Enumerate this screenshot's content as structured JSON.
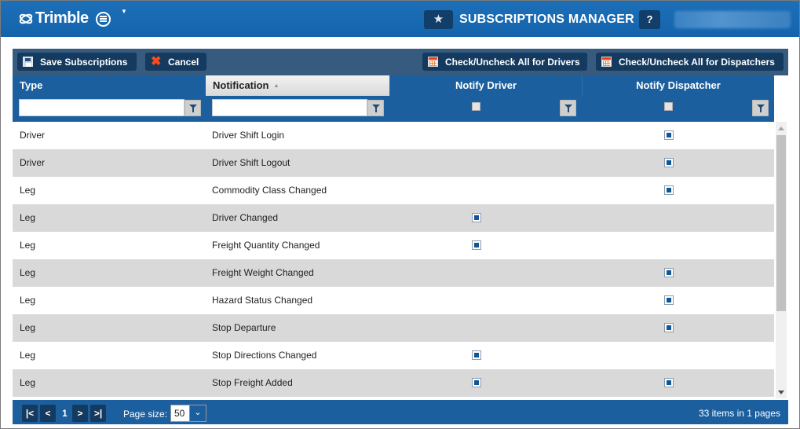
{
  "header": {
    "brand": "Trimble",
    "title": "SUBSCRIPTIONS MANAGER",
    "help_label": "?",
    "star_icon": "star-icon"
  },
  "toolbar": {
    "save_label": "Save Subscriptions",
    "cancel_label": "Cancel",
    "check_drivers_label": "Check/Uncheck All for Drivers",
    "check_dispatchers_label": "Check/Uncheck All for Dispatchers"
  },
  "columns": {
    "type": "Type",
    "notification": "Notification",
    "notify_driver": "Notify Driver",
    "notify_dispatcher": "Notify Dispatcher"
  },
  "rows": [
    {
      "type": "Driver",
      "notification": "Driver Shift Login",
      "driver": false,
      "dispatcher": true
    },
    {
      "type": "Driver",
      "notification": "Driver Shift Logout",
      "driver": false,
      "dispatcher": true
    },
    {
      "type": "Leg",
      "notification": "Commodity Class Changed",
      "driver": false,
      "dispatcher": true
    },
    {
      "type": "Leg",
      "notification": "Driver Changed",
      "driver": true,
      "dispatcher": false
    },
    {
      "type": "Leg",
      "notification": "Freight Quantity Changed",
      "driver": true,
      "dispatcher": false
    },
    {
      "type": "Leg",
      "notification": "Freight Weight Changed",
      "driver": false,
      "dispatcher": true
    },
    {
      "type": "Leg",
      "notification": "Hazard Status Changed",
      "driver": false,
      "dispatcher": true
    },
    {
      "type": "Leg",
      "notification": "Stop Departure",
      "driver": false,
      "dispatcher": true
    },
    {
      "type": "Leg",
      "notification": "Stop Directions Changed",
      "driver": true,
      "dispatcher": false
    },
    {
      "type": "Leg",
      "notification": "Stop Freight Added",
      "driver": true,
      "dispatcher": true
    }
  ],
  "pager": {
    "first": "|<",
    "prev": "<",
    "page": "1",
    "next": ">",
    "last": ">|",
    "page_size_label": "Page size:",
    "page_size": "50",
    "info": "33 items in 1 pages"
  },
  "colors": {
    "header_blue": "#1464ac",
    "toolbar": "#365b7f",
    "button": "#143a60",
    "grid_header": "#1c5f9f",
    "row_alt": "#d9d9d9",
    "check_fill": "#0f5697"
  }
}
